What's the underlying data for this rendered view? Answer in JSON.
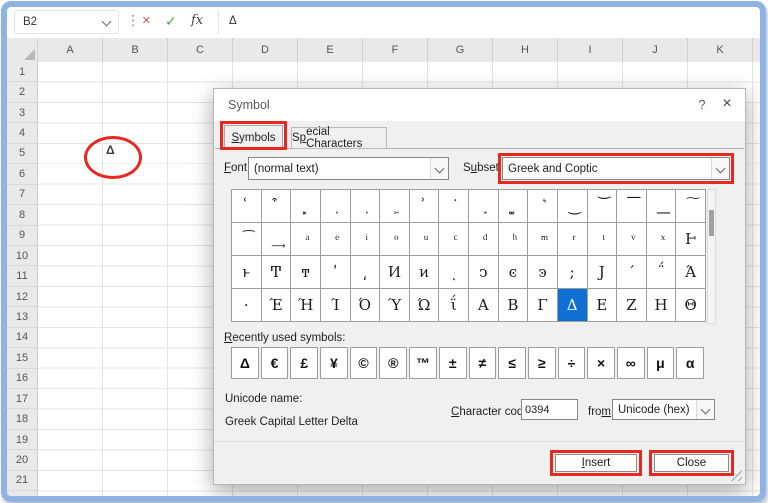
{
  "colors": {
    "annotation_red": "#e8271e",
    "frame_blue": "#8fb3e2",
    "selection_blue": "#1070d4",
    "cancel_red": "#d9594f",
    "enter_green": "#3fa848"
  },
  "formula_bar": {
    "name_box": "B2",
    "dots_icon": "⋮",
    "cancel_icon": "×",
    "enter_icon": "✓",
    "fx_icon": "fx",
    "formula": "Δ"
  },
  "spreadsheet": {
    "columns": [
      "A",
      "B",
      "C",
      "D",
      "E",
      "F",
      "G",
      "H",
      "I",
      "J",
      "K"
    ],
    "rows": [
      "1",
      "2",
      "3",
      "4",
      "5",
      "6",
      "7",
      "8",
      "9",
      "10",
      "11",
      "12",
      "13",
      "14",
      "15",
      "16",
      "17",
      "18",
      "19",
      "20",
      "21"
    ],
    "selected_cell": {
      "ref": "B2",
      "value": "Δ"
    }
  },
  "dialog": {
    "title": "Symbol",
    "help_icon": "?",
    "close_icon": "×",
    "tabs": {
      "symbols": {
        "pre": "",
        "accel": "S",
        "post": "ymbols"
      },
      "special": {
        "pre": "S",
        "accel": "p",
        "post": "ecial Characters"
      }
    },
    "font": {
      "label": {
        "pre": "",
        "accel": "F",
        "post": "ont:"
      },
      "value": "(normal text)"
    },
    "subset": {
      "label": {
        "pre": "S",
        "accel": "u",
        "post": "bset:"
      },
      "value": "Greek and Coptic"
    },
    "grid": {
      "rows": [
        [
          " ͑",
          " ͒",
          " ͓",
          " ͔",
          " ͕",
          " ͖",
          " ͗",
          " ͘",
          " ͙",
          " ͚",
          " ͛",
          " ͜",
          " ͝",
          " ͞",
          " ͟",
          " ͠"
        ],
        [
          " ͡",
          " ͢",
          " ͣ",
          " ͤ",
          " ͥ",
          " ͦ",
          " ͧ",
          " ͨ",
          " ͩ",
          " ͪ",
          " ͫ",
          " ͬ",
          " ͭ",
          " ͮ",
          " ͯ",
          "Ͱ"
        ],
        [
          "ͱ",
          "Ͳ",
          "ͳ",
          "ʹ",
          "͵",
          "Ͷ",
          "ͷ",
          "ͺ",
          "ͻ",
          "ͼ",
          "ͽ",
          ";",
          "Ϳ",
          "΄",
          "΅",
          "Ά"
        ],
        [
          "·",
          "Έ",
          "Ή",
          "Ί",
          "Ό",
          "Ύ",
          "Ώ",
          "ΐ",
          "Α",
          "Β",
          "Γ",
          "Δ",
          "Ε",
          "Ζ",
          "Η",
          "Θ"
        ]
      ],
      "selected": {
        "row": 3,
        "col": 11
      }
    },
    "recent": {
      "label": {
        "pre": "",
        "accel": "R",
        "post": "ecently used symbols:"
      },
      "symbols": [
        "Δ",
        "€",
        "£",
        "¥",
        "©",
        "®",
        "™",
        "±",
        "≠",
        "≤",
        "≥",
        "÷",
        "×",
        "∞",
        "μ",
        "α"
      ]
    },
    "unicode_name_label": "Unicode name:",
    "unicode_name_value": "Greek Capital Letter Delta",
    "char_code": {
      "label": {
        "pre": "",
        "accel": "C",
        "post": "haracter code:"
      },
      "value": "0394"
    },
    "from": {
      "label": {
        "pre": "fro",
        "accel": "m",
        "post": ":"
      },
      "value": "Unicode (hex)"
    },
    "insert_button": {
      "pre": "",
      "accel": "I",
      "post": "nsert"
    },
    "close_button": {
      "pre": "",
      "accel": "",
      "post": "Close"
    }
  }
}
